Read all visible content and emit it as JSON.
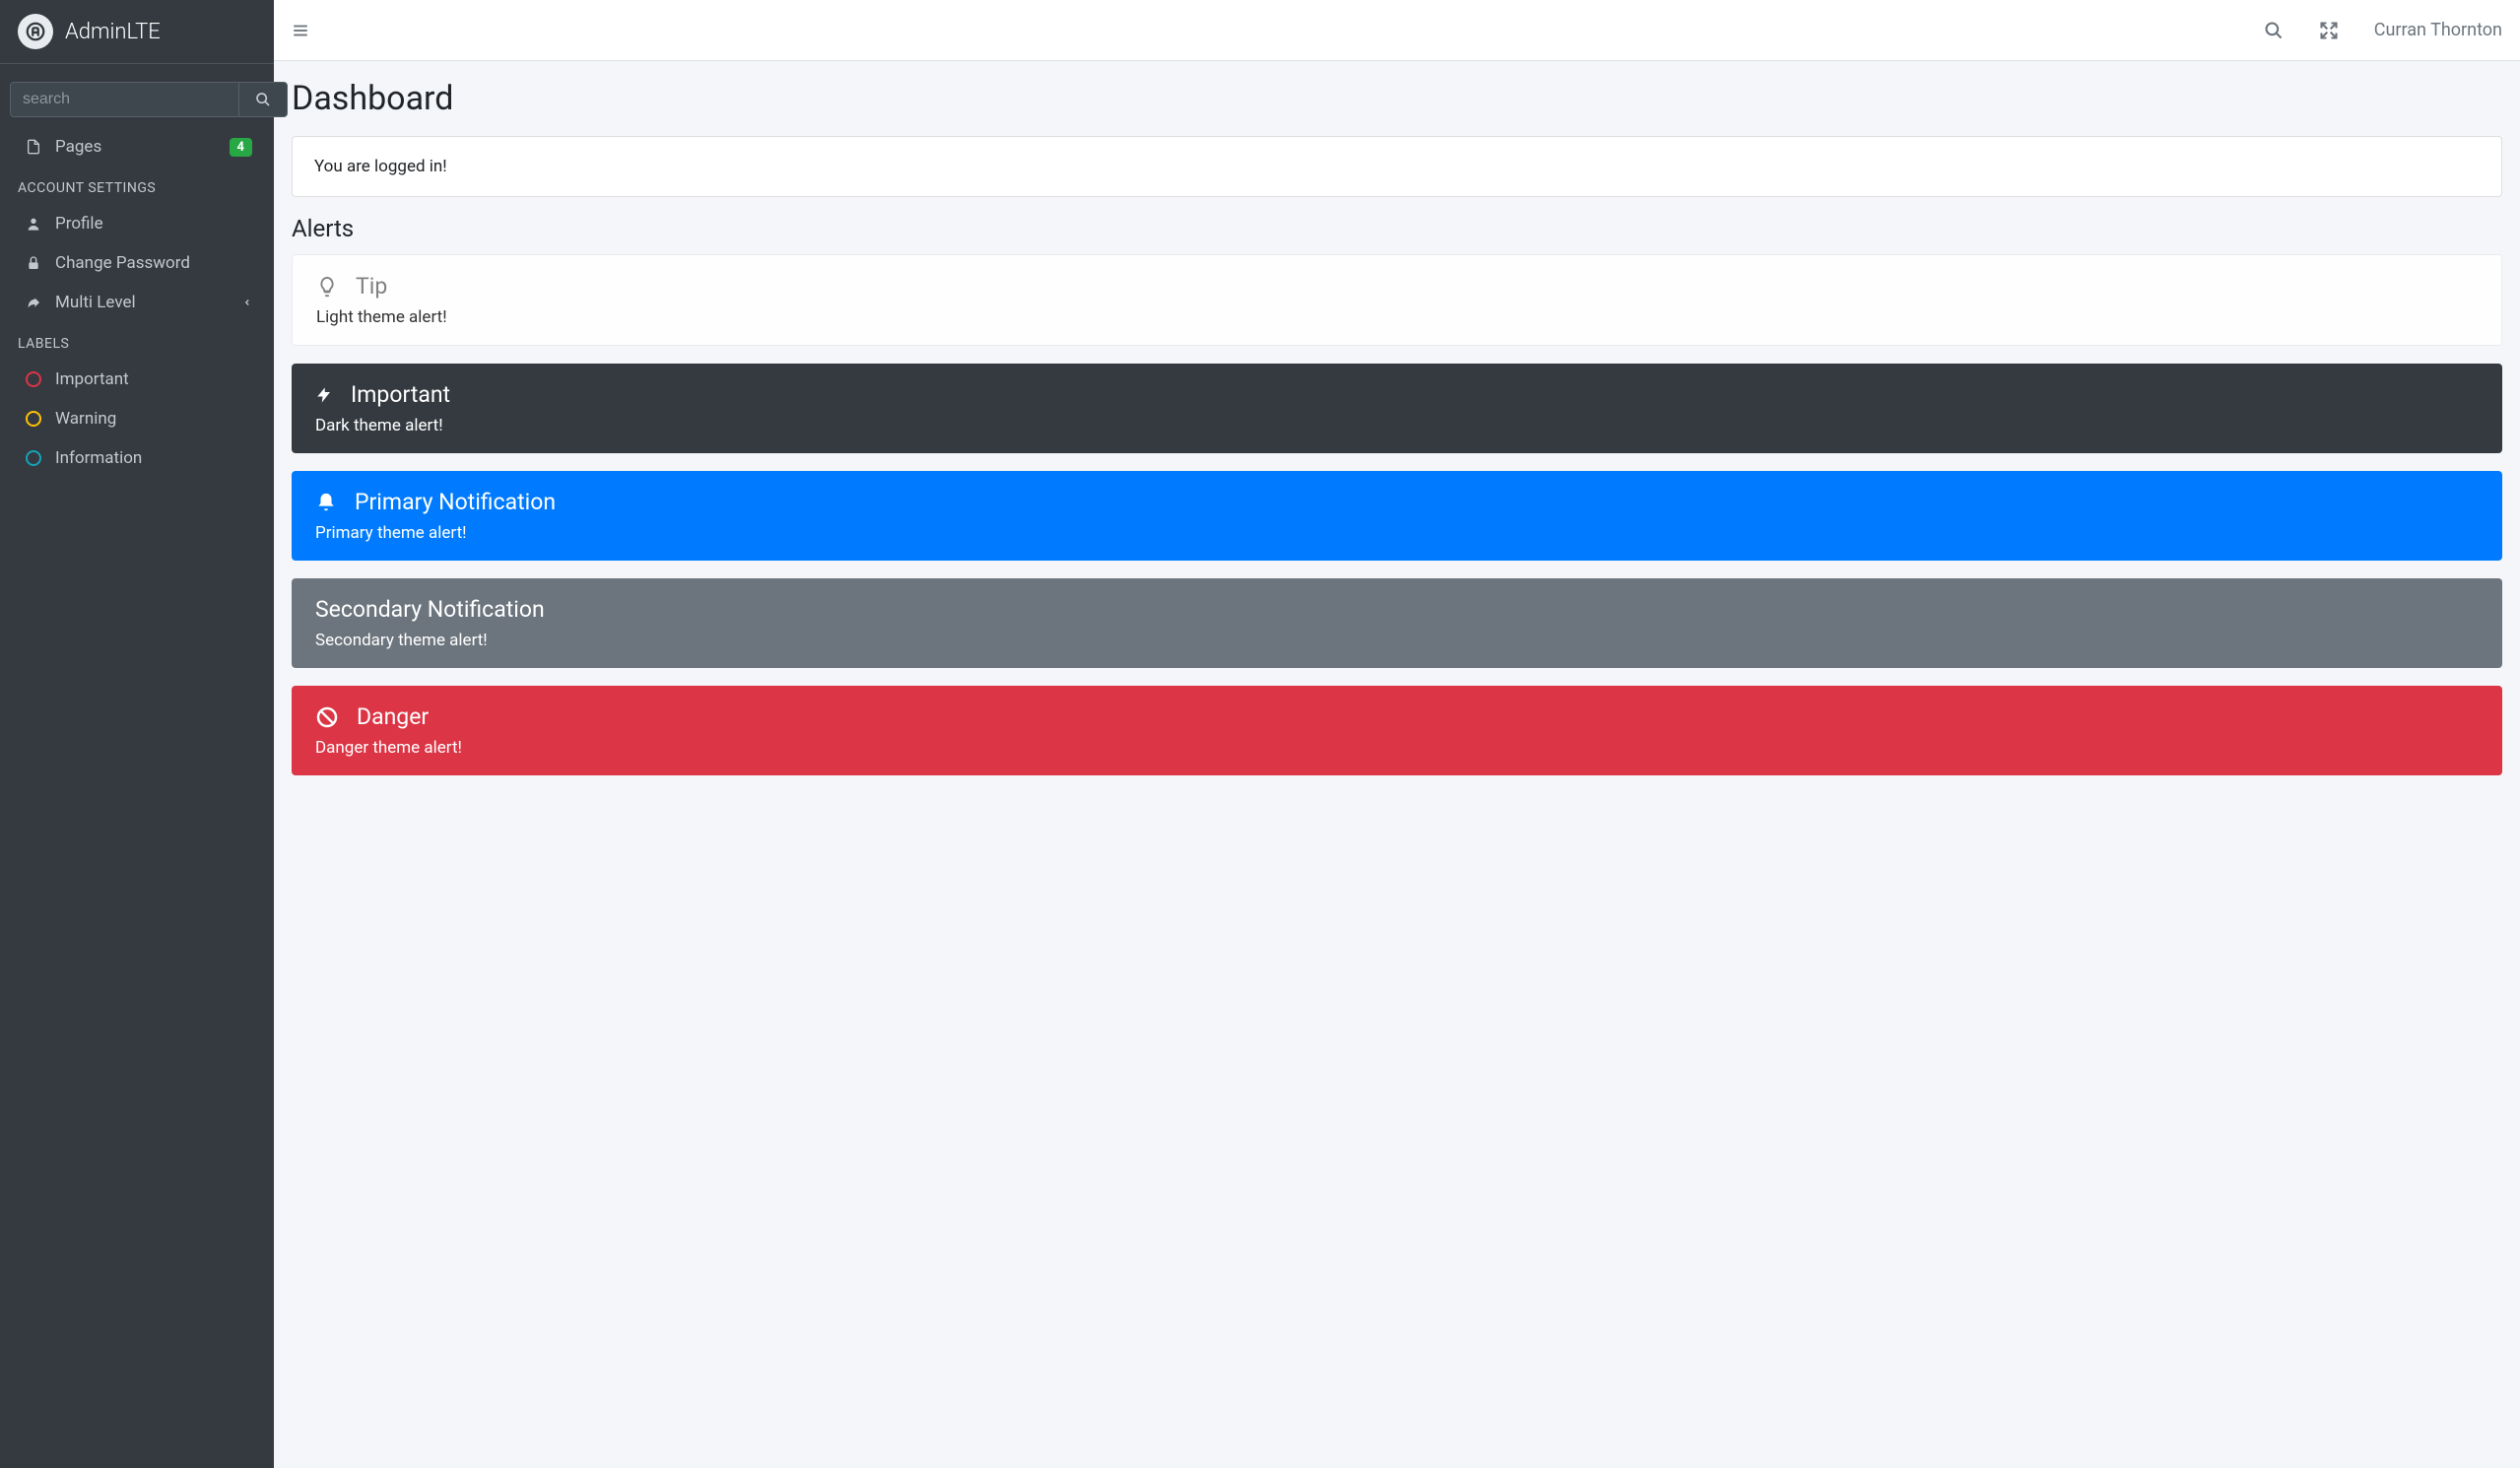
{
  "brand": {
    "name": "AdminLTE"
  },
  "sidebar": {
    "search_placeholder": "search",
    "nav1": [
      {
        "label": "Pages",
        "badge": "4"
      }
    ],
    "section_account": "ACCOUNT SETTINGS",
    "account_items": [
      {
        "label": "Profile"
      },
      {
        "label": "Change Password"
      },
      {
        "label": "Multi Level"
      }
    ],
    "section_labels": "LABELS",
    "label_items": [
      {
        "label": "Important",
        "color": "#dc3545"
      },
      {
        "label": "Warning",
        "color": "#ffc107"
      },
      {
        "label": "Information",
        "color": "#17a2b8"
      }
    ]
  },
  "topbar": {
    "username": "Curran Thornton"
  },
  "page": {
    "title": "Dashboard",
    "logged_in_message": "You are logged in!",
    "alerts_heading": "Alerts"
  },
  "alerts": [
    {
      "type": "light",
      "title": "Tip",
      "body": "Light theme alert!"
    },
    {
      "type": "dark",
      "title": "Important",
      "body": "Dark theme alert!"
    },
    {
      "type": "primary",
      "title": "Primary Notification",
      "body": "Primary theme alert!"
    },
    {
      "type": "secondary",
      "title": "Secondary Notification",
      "body": "Secondary theme alert!"
    },
    {
      "type": "danger",
      "title": "Danger",
      "body": "Danger theme alert!"
    }
  ]
}
